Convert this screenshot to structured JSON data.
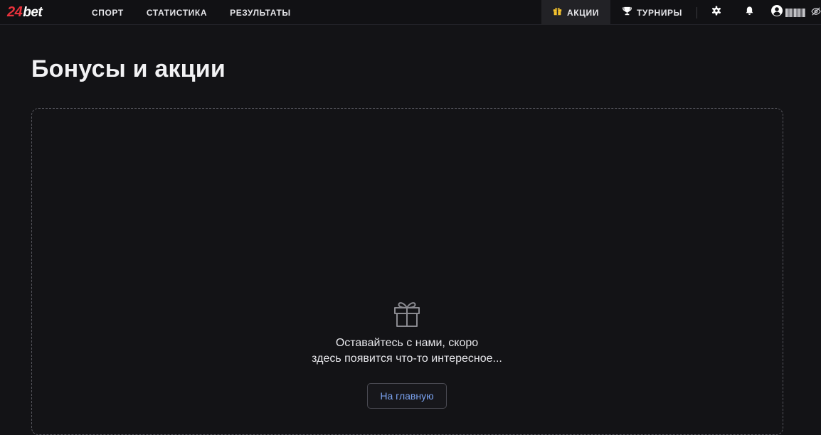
{
  "brand": {
    "logo_number": "24",
    "logo_text": "bet",
    "accent_color": "#e8323c"
  },
  "nav": {
    "items": [
      {
        "label": "СПОРТ"
      },
      {
        "label": "СТАТИСТИКА"
      },
      {
        "label": "РЕЗУЛЬТАТЫ"
      }
    ]
  },
  "header_right": {
    "promotions_label": "АКЦИИ",
    "promotions_icon": "gift-icon",
    "promotions_icon_color": "#f2c12e",
    "tournaments_label": "ТУРНИРЫ",
    "tournaments_icon": "trophy-icon",
    "settings_icon": "gear-icon",
    "notifications_icon": "bell-icon",
    "account_icon": "user-circle-icon",
    "visibility_icon": "eye-off-icon"
  },
  "page": {
    "title": "Бонусы и акции"
  },
  "empty_state": {
    "icon": "gift-icon",
    "line1": "Оставайтесь с нами, скоро",
    "line2": "здесь появится что-то интересное...",
    "button_label": "На главную",
    "button_color": "#7aa2f0"
  }
}
